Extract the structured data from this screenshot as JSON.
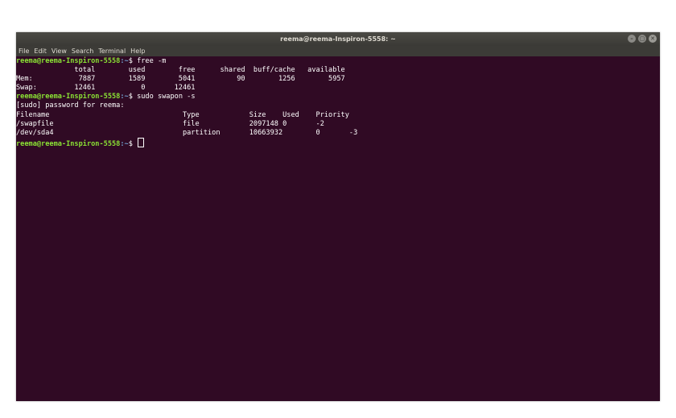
{
  "window": {
    "title": "reema@reema-Inspiron-5558: ~",
    "controls": [
      "–",
      "▢",
      "✕"
    ]
  },
  "menu": {
    "file": "File",
    "edit": "Edit",
    "view": "View",
    "search": "Search",
    "terminal": "Terminal",
    "help": "Help"
  },
  "terminal": {
    "prompt_user": "reema@reema-Inspiron-5558",
    "prompt_path": ":~",
    "prompt_symbol": "$ ",
    "cmd1": "free -m",
    "free_header": "              total        used        free      shared  buff/cache   available",
    "free_mem": "Mem:           7887        1589        5041          90        1256        5957",
    "free_swap": "Swap:         12461           0       12461",
    "cmd2": "sudo swapon -s",
    "sudo_prompt": "[sudo] password for reema:",
    "swap_header": "Filename                                Type            Size    Used    Priority",
    "swap_row1": "/swapfile                               file            2097148 0       -2",
    "swap_row2": "/dev/sda4                               partition       10663932        0       -3"
  }
}
